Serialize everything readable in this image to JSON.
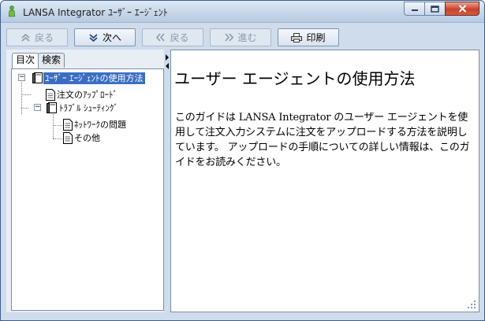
{
  "window": {
    "title": "LANSA Integrator ﾕｰｻﾞｰ ｴｰｼﾞｪﾝﾄ"
  },
  "toolbar": {
    "hide_label": "戻る",
    "next_label": "次へ",
    "back_label": "戻る",
    "forward_label": "進む",
    "print_label": "印刷"
  },
  "sidebar": {
    "tabs": [
      {
        "label": "目次",
        "active": true
      },
      {
        "label": "検索",
        "active": false
      }
    ],
    "tree": {
      "root": {
        "label": "ﾕｰｻﾞｰ ｴｰｼﾞｪﾝﾄの使用方法"
      },
      "items": [
        {
          "label": "注文のｱｯﾌﾟﾛｰﾄﾞ"
        },
        {
          "label": "ﾄﾗﾌﾞﾙ ｼｭｰﾃｨﾝｸﾞ"
        },
        {
          "label": "ﾈｯﾄﾜｰｸの問題"
        },
        {
          "label": "その他"
        }
      ]
    }
  },
  "content": {
    "title": "ユーザー エージェントの使用方法",
    "body": "このガイドは LANSA Integrator のユーザー エージェントを使用して注文入力システムに注文をアップロードする方法を説明しています。 アップロードの手順についての詳しい情報は、このガイドをお読みください。"
  },
  "colors": {
    "selection": "#3a6ec2",
    "window_frame": "#cfdcec",
    "close_button": "#c8412a"
  }
}
